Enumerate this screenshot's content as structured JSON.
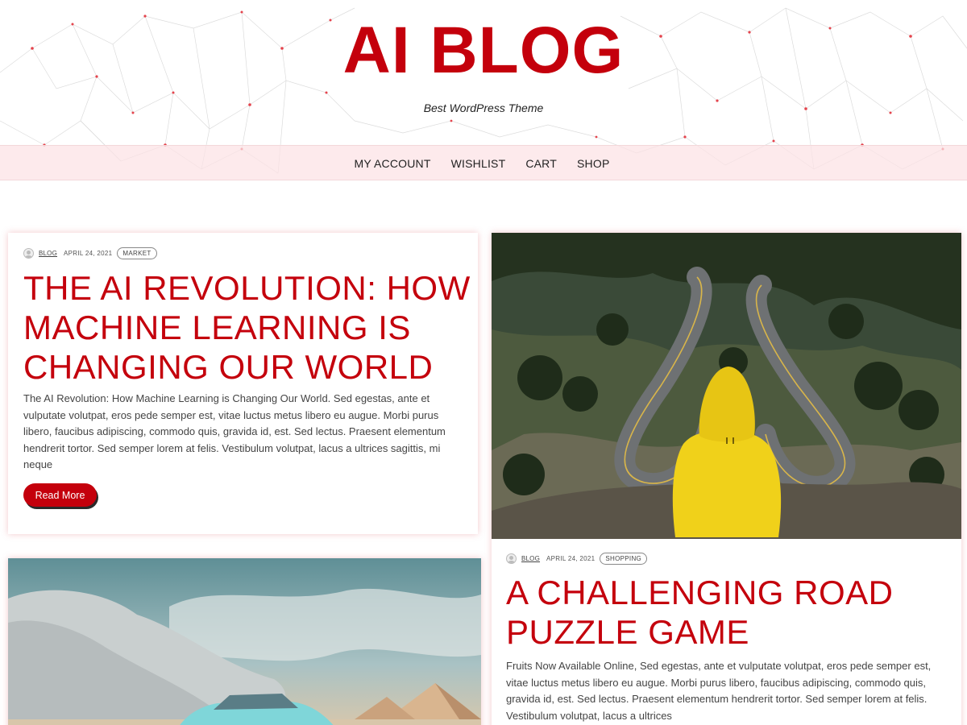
{
  "site": {
    "title": "AI BLOG",
    "tagline": "Best WordPress Theme"
  },
  "nav": {
    "items": [
      "MY ACCOUNT",
      "WISHLIST",
      "CART",
      "SHOP"
    ]
  },
  "posts": [
    {
      "author": "BLOG",
      "date": "APRIL 24, 2021",
      "category": "MARKET",
      "title": "THE AI REVOLUTION: HOW MACHINE LEARNING IS CHANGING OUR WORLD",
      "excerpt": "The AI Revolution: How Machine Learning is Changing Our World. Sed egestas, ante et vulputate volutpat, eros pede semper est, vitae luctus metus libero eu augue. Morbi purus libero, faucibus adipiscing, commodo quis, gravida id, est. Sed lectus. Praesent elementum hendrerit tortor. Sed semper lorem at felis. Vestibulum volutpat, lacus a ultrices sagittis, mi neque",
      "read_more": "Read More"
    },
    {
      "author": "BLOG",
      "date": "APRIL 24, 2021",
      "category": "SHOPPING",
      "title": "A CHALLENGING ROAD PUZZLE GAME",
      "excerpt": "Fruits Now Available Online, Sed egestas, ante et vulputate volutpat, eros pede semper est, vitae luctus metus libero eu augue. Morbi purus libero, faucibus adipiscing, commodo quis, gravida id, est. Sed lectus. Praesent elementum hendrerit tortor. Sed semper lorem at felis. Vestibulum volutpat, lacus a ultrices"
    }
  ],
  "colors": {
    "accent": "#c4000c",
    "nav_bg": "#fce2e4",
    "text": "#444444"
  },
  "icons": {
    "avatar": "user-avatar-icon"
  }
}
